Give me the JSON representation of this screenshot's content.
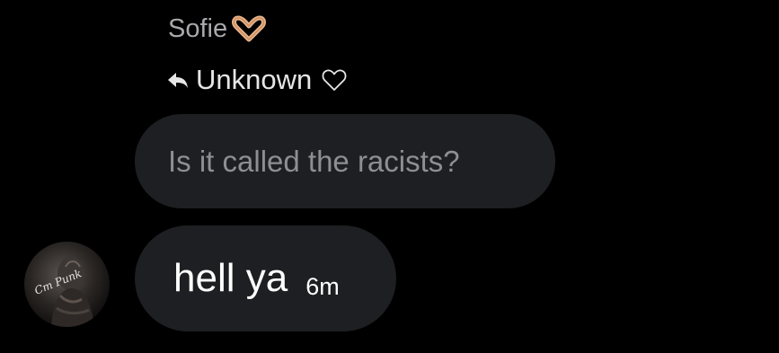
{
  "thread": {
    "sender_name": "Sofie",
    "sender_emoji_icon": "heart-hands-icon",
    "reply_icon": "reply-arrow-icon",
    "reply_to_label": "Unknown",
    "reply_heart_icon": "heart-outline-icon"
  },
  "quoted_message": {
    "text": "Is it called the racists?"
  },
  "message": {
    "text": "hell ya",
    "timestamp": "6m"
  },
  "avatar": {
    "caption": "Cm Punk"
  },
  "colors": {
    "background": "#000000",
    "bubble": "#1e1f22",
    "quoted_text": "#8e8e93",
    "sender_name": "#a8a8ad",
    "message_text": "#ffffff"
  }
}
